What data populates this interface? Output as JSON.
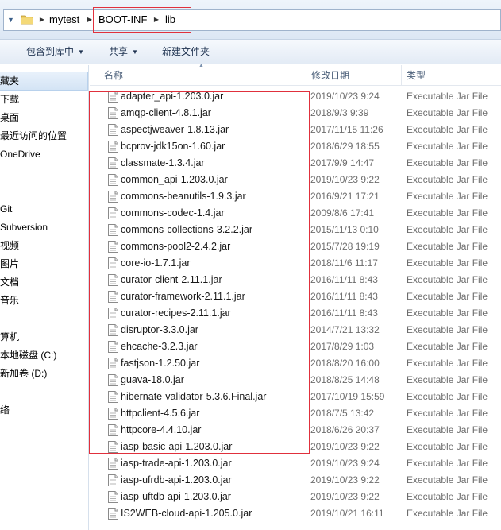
{
  "address_bar": {
    "breadcrumbs": [
      "mytest",
      "BOOT-INF",
      "lib"
    ]
  },
  "toolbar": {
    "include_in_library": "包含到库中",
    "share": "共享",
    "new_folder": "新建文件夹"
  },
  "nav_pane": {
    "items": [
      "藏夹",
      "下载",
      "桌面",
      "最近访问的位置",
      "OneDrive",
      "Git",
      "Subversion",
      "视频",
      "图片",
      "文档",
      "音乐",
      "算机",
      "本地磁盘 (C:)",
      "新加卷 (D:)",
      "络"
    ]
  },
  "columns": {
    "name": "名称",
    "modified": "修改日期",
    "type": "类型"
  },
  "files": [
    {
      "name": "adapter_api-1.203.0.jar",
      "date": "2019/10/23 9:24",
      "type": "Executable Jar File"
    },
    {
      "name": "amqp-client-4.8.1.jar",
      "date": "2018/9/3 9:39",
      "type": "Executable Jar File"
    },
    {
      "name": "aspectjweaver-1.8.13.jar",
      "date": "2017/11/15 11:26",
      "type": "Executable Jar File"
    },
    {
      "name": "bcprov-jdk15on-1.60.jar",
      "date": "2018/6/29 18:55",
      "type": "Executable Jar File"
    },
    {
      "name": "classmate-1.3.4.jar",
      "date": "2017/9/9 14:47",
      "type": "Executable Jar File"
    },
    {
      "name": "common_api-1.203.0.jar",
      "date": "2019/10/23 9:22",
      "type": "Executable Jar File"
    },
    {
      "name": "commons-beanutils-1.9.3.jar",
      "date": "2016/9/21 17:21",
      "type": "Executable Jar File"
    },
    {
      "name": "commons-codec-1.4.jar",
      "date": "2009/8/6 17:41",
      "type": "Executable Jar File"
    },
    {
      "name": "commons-collections-3.2.2.jar",
      "date": "2015/11/13 0:10",
      "type": "Executable Jar File"
    },
    {
      "name": "commons-pool2-2.4.2.jar",
      "date": "2015/7/28 19:19",
      "type": "Executable Jar File"
    },
    {
      "name": "core-io-1.7.1.jar",
      "date": "2018/11/6 11:17",
      "type": "Executable Jar File"
    },
    {
      "name": "curator-client-2.11.1.jar",
      "date": "2016/11/11 8:43",
      "type": "Executable Jar File"
    },
    {
      "name": "curator-framework-2.11.1.jar",
      "date": "2016/11/11 8:43",
      "type": "Executable Jar File"
    },
    {
      "name": "curator-recipes-2.11.1.jar",
      "date": "2016/11/11 8:43",
      "type": "Executable Jar File"
    },
    {
      "name": "disruptor-3.3.0.jar",
      "date": "2014/7/21 13:32",
      "type": "Executable Jar File"
    },
    {
      "name": "ehcache-3.2.3.jar",
      "date": "2017/8/29 1:03",
      "type": "Executable Jar File"
    },
    {
      "name": "fastjson-1.2.50.jar",
      "date": "2018/8/20 16:00",
      "type": "Executable Jar File"
    },
    {
      "name": "guava-18.0.jar",
      "date": "2018/8/25 14:48",
      "type": "Executable Jar File"
    },
    {
      "name": "hibernate-validator-5.3.6.Final.jar",
      "date": "2017/10/19 15:59",
      "type": "Executable Jar File"
    },
    {
      "name": "httpclient-4.5.6.jar",
      "date": "2018/7/5 13:42",
      "type": "Executable Jar File"
    },
    {
      "name": "httpcore-4.4.10.jar",
      "date": "2018/6/26 20:37",
      "type": "Executable Jar File"
    },
    {
      "name": "iasp-basic-api-1.203.0.jar",
      "date": "2019/10/23 9:22",
      "type": "Executable Jar File"
    },
    {
      "name": "iasp-trade-api-1.203.0.jar",
      "date": "2019/10/23 9:24",
      "type": "Executable Jar File"
    },
    {
      "name": "iasp-ufrdb-api-1.203.0.jar",
      "date": "2019/10/23 9:22",
      "type": "Executable Jar File"
    },
    {
      "name": "iasp-uftdb-api-1.203.0.jar",
      "date": "2019/10/23 9:22",
      "type": "Executable Jar File"
    },
    {
      "name": "IS2WEB-cloud-api-1.205.0.jar",
      "date": "2019/10/21 16:11",
      "type": "Executable Jar File"
    }
  ],
  "colors": {
    "highlight": "#e0303c",
    "header_text": "#4c607a",
    "toolbar_text": "#1e3250"
  }
}
